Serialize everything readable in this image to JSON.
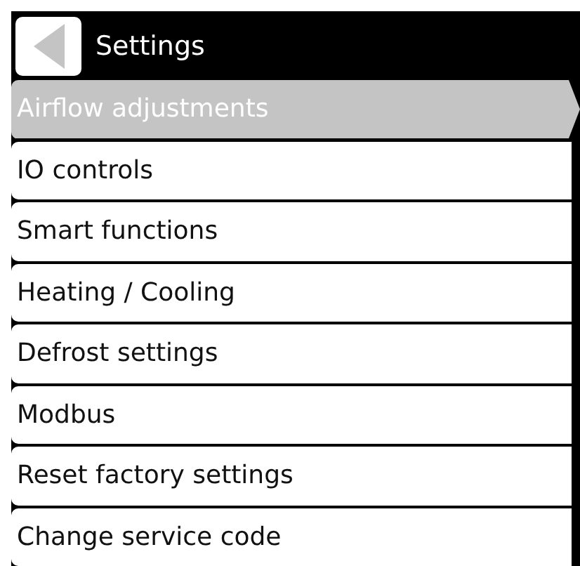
{
  "header": {
    "title": "Settings"
  },
  "menu_items": [
    {
      "label": "Airflow adjustments",
      "selected": true
    },
    {
      "label": "IO controls",
      "selected": false
    },
    {
      "label": "Smart functions",
      "selected": false
    },
    {
      "label": "Heating / Cooling",
      "selected": false
    },
    {
      "label": "Defrost settings",
      "selected": false
    },
    {
      "label": "Modbus",
      "selected": false
    },
    {
      "label": "Reset factory settings",
      "selected": false
    },
    {
      "label": "Change service code",
      "selected": false
    }
  ]
}
